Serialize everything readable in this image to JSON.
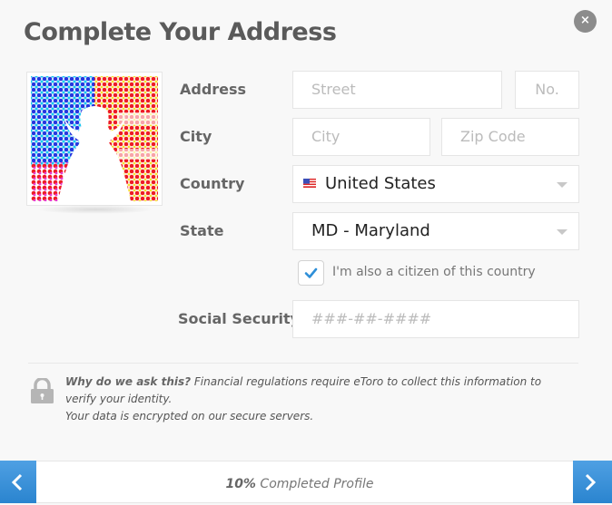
{
  "dialog": {
    "title": "Complete Your Address",
    "close_label": "×"
  },
  "form": {
    "address": {
      "label": "Address",
      "street_placeholder": "Street",
      "number_placeholder": "No."
    },
    "city": {
      "label": "City",
      "city_placeholder": "City",
      "zip_placeholder": "Zip Code"
    },
    "country": {
      "label": "Country",
      "value": "United States",
      "flag": "us-flag-icon"
    },
    "state": {
      "label": "State",
      "value": "MD - Maryland"
    },
    "citizen_checkbox": {
      "label": "I'm also a citizen of this country",
      "checked": true
    },
    "ssn": {
      "label": "Social Security",
      "placeholder": "###-##-####"
    }
  },
  "info": {
    "heading": "Why do we ask this?",
    "line1": " Financial regulations require eToro to collect this information to verify your identity.",
    "line2": "Your data is encrypted on our secure servers."
  },
  "footer": {
    "progress_value": "10%",
    "progress_text": " Completed Profile",
    "progress_percent": 10,
    "accent_color": "#3a91d9"
  }
}
